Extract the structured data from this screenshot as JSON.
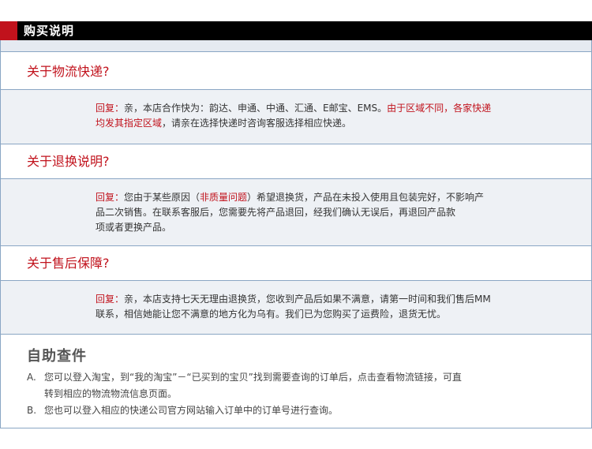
{
  "header": {
    "title": "购买说明"
  },
  "sections": [
    {
      "question": "关于物流快递?",
      "reply_label": "回复：",
      "lines": [
        [
          {
            "t": "回复：",
            "red": true
          },
          {
            "t": "亲，本店合作快为：韵达、申通、中通、汇通、E邮宝、EMS。",
            "red": false
          },
          {
            "t": "由于区域不同，各家快递",
            "red": true
          }
        ],
        [
          {
            "t": "均发其指定区域",
            "red": true
          },
          {
            "t": "，请亲在选择快递时咨询客服选择相应快递。",
            "red": false
          }
        ]
      ]
    },
    {
      "question": "关于退换说明?",
      "lines": [
        [
          {
            "t": "回复：",
            "red": true
          },
          {
            "t": "您由于某些原因（",
            "red": false
          },
          {
            "t": "非质量问题",
            "red": true
          },
          {
            "t": "）希望退换货，产品在未投入使用且包装完好，不影响产",
            "red": false
          }
        ],
        [
          {
            "t": "品二次销售。在联系客服后，您需要先将产品退回，经我们确认无误后，再退回产品款",
            "red": false
          }
        ],
        [
          {
            "t": "项或者更换产品。",
            "red": false
          }
        ]
      ]
    },
    {
      "question": "关于售后保障?",
      "lines": [
        [
          {
            "t": "回复：",
            "red": true
          },
          {
            "t": "亲，本店支持七天无理由退换货，您收到产品后如果不满意，请第一时间和我们售后MM",
            "red": false
          }
        ],
        [
          {
            "t": "联系，相信她能让您不满意的地方化为乌有。我们已为您购买了运费险，退货无忧。",
            "red": false
          }
        ]
      ]
    }
  ],
  "self_service": {
    "title": "自助查件",
    "a_mark": "A.",
    "a_line1": "您可以登入淘宝，到“我的淘宝”－“已买到的宝贝”找到需要查询的订单后，点击查看物流链接，可直",
    "a_line2": "转到相应的物流物流信息页面。",
    "b_mark": "B.",
    "b_line1": "您也可以登入相应的快递公司官方网站输入订单中的订单号进行查询。"
  }
}
